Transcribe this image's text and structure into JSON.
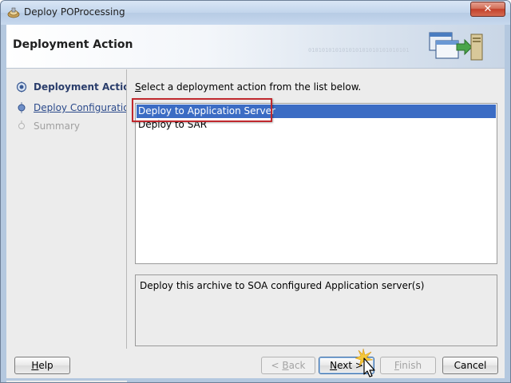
{
  "window": {
    "title": "Deploy POProcessing",
    "close_label": "✕"
  },
  "header": {
    "title": "Deployment Action",
    "binary_text": "010101010101010101010101010101"
  },
  "steps": [
    {
      "label": "Deployment Action",
      "state": "active"
    },
    {
      "label": "Deploy Configuration",
      "state": "link"
    },
    {
      "label": "Summary",
      "state": "disabled"
    }
  ],
  "scroll": {
    "left": "‹",
    "right": "›",
    "thumb": "⋮"
  },
  "main": {
    "instruction_prefix": "S",
    "instruction_rest": "elect a deployment action from the list below.",
    "options": [
      {
        "label": "Deploy to Application Server",
        "selected": true
      },
      {
        "label": "Deploy to SAR",
        "selected": false
      }
    ],
    "description": "Deploy this archive to SOA configured Application server(s)"
  },
  "buttons": {
    "help": {
      "mnemonic": "H",
      "rest": "elp"
    },
    "back": {
      "arrow": "< ",
      "mnemonic": "B",
      "rest": "ack"
    },
    "next": {
      "mnemonic": "N",
      "rest": "ext",
      "arrow": " >"
    },
    "finish": {
      "mnemonic": "F",
      "rest": "inish"
    },
    "cancel": {
      "label": "Cancel"
    }
  },
  "colors": {
    "selection": "#3b6cc4",
    "highlight_border": "#c0282d",
    "active_step": "#2a3d6b"
  }
}
